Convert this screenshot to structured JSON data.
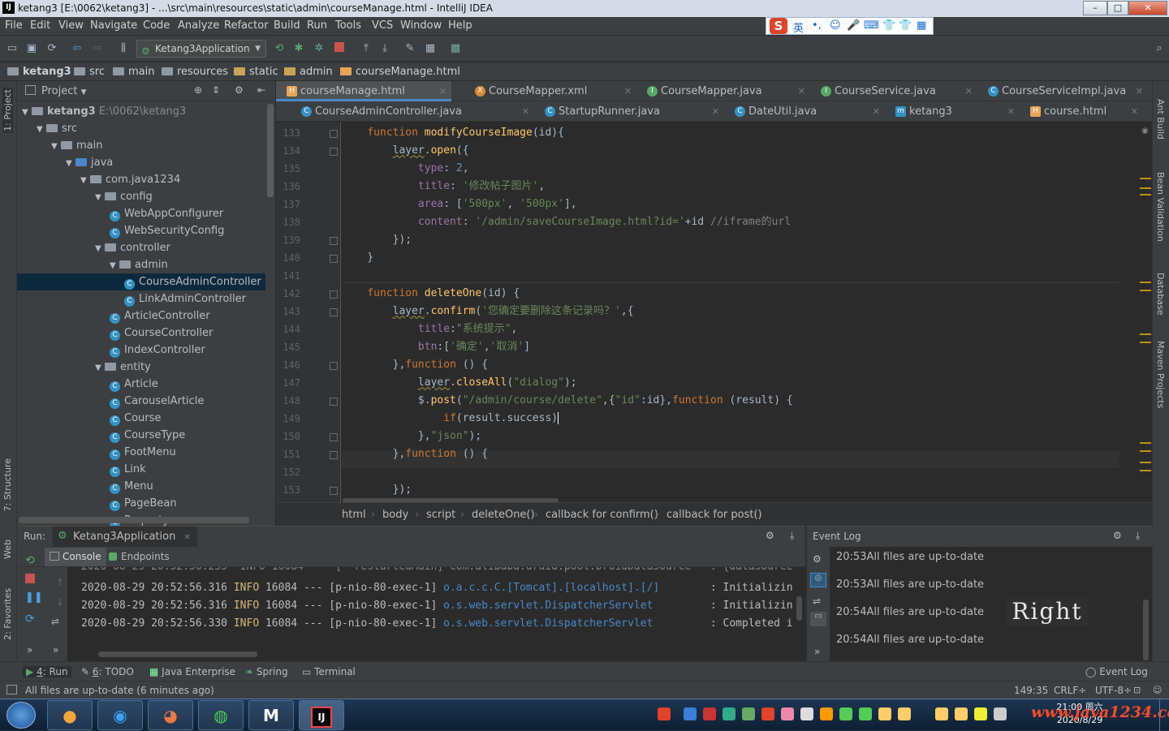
{
  "window": {
    "title": "ketang3 [E:\\0062\\ketang3] - ...\\src\\main\\resources\\static\\admin\\courseManage.html - IntelliJ IDEA",
    "app_icon": "IJ",
    "min": "–",
    "max": "□",
    "close": "✕"
  },
  "menu": [
    "File",
    "Edit",
    "View",
    "Navigate",
    "Code",
    "Analyze",
    "Refactor",
    "Build",
    "Run",
    "Tools",
    "VCS",
    "Window",
    "Help"
  ],
  "ime": {
    "logo": "S",
    "lang": "英",
    "items": [
      "•,",
      "☺",
      "🎤",
      "⌨",
      "👕",
      "👕",
      "▦"
    ]
  },
  "toolbar": {
    "run_config": "Ketang3Application"
  },
  "nav": {
    "crumbs": [
      "ketang3",
      "src",
      "main",
      "resources",
      "static",
      "admin",
      "courseManage.html"
    ]
  },
  "project": {
    "title": "Project",
    "tree": [
      {
        "label": "ketang3",
        "extra": "E:\\0062\\ketang3",
        "depth": 0,
        "type": "module",
        "open": true
      },
      {
        "label": "src",
        "depth": 1,
        "type": "folder",
        "open": true
      },
      {
        "label": "main",
        "depth": 2,
        "type": "folder",
        "open": true
      },
      {
        "label": "java",
        "depth": 3,
        "type": "folder",
        "open": true
      },
      {
        "label": "com.java1234",
        "depth": 4,
        "type": "package",
        "open": true
      },
      {
        "label": "config",
        "depth": 5,
        "type": "package",
        "open": true
      },
      {
        "label": "WebAppConfigurer",
        "depth": 6,
        "type": "class"
      },
      {
        "label": "WebSecurityConfig",
        "depth": 6,
        "type": "class"
      },
      {
        "label": "controller",
        "depth": 5,
        "type": "package",
        "open": true
      },
      {
        "label": "admin",
        "depth": 6,
        "type": "package",
        "open": true
      },
      {
        "label": "CourseAdminController",
        "depth": 7,
        "type": "class",
        "selected": true
      },
      {
        "label": "LinkAdminController",
        "depth": 7,
        "type": "class"
      },
      {
        "label": "ArticleController",
        "depth": 6,
        "type": "class"
      },
      {
        "label": "CourseController",
        "depth": 6,
        "type": "class"
      },
      {
        "label": "IndexController",
        "depth": 6,
        "type": "class"
      },
      {
        "label": "entity",
        "depth": 5,
        "type": "package",
        "open": true
      },
      {
        "label": "Article",
        "depth": 6,
        "type": "class"
      },
      {
        "label": "CarouselArticle",
        "depth": 6,
        "type": "class"
      },
      {
        "label": "Course",
        "depth": 6,
        "type": "class"
      },
      {
        "label": "CourseType",
        "depth": 6,
        "type": "class"
      },
      {
        "label": "FootMenu",
        "depth": 6,
        "type": "class"
      },
      {
        "label": "Link",
        "depth": 6,
        "type": "class"
      },
      {
        "label": "Menu",
        "depth": 6,
        "type": "class"
      },
      {
        "label": "PageBean",
        "depth": 6,
        "type": "class"
      },
      {
        "label": "Property",
        "depth": 6,
        "type": "class"
      }
    ]
  },
  "tabs_row1": [
    {
      "label": "courseManage.html",
      "icon": "html",
      "active": true
    },
    {
      "label": "CourseMapper.xml",
      "icon": "xml"
    },
    {
      "label": "CourseMapper.java",
      "icon": "interface"
    },
    {
      "label": "CourseService.java",
      "icon": "interface"
    },
    {
      "label": "CourseServiceImpl.java",
      "icon": "class"
    }
  ],
  "tabs_row2": [
    {
      "label": "CourseAdminController.java",
      "icon": "class"
    },
    {
      "label": "StartupRunner.java",
      "icon": "class"
    },
    {
      "label": "DateUtil.java",
      "icon": "class"
    },
    {
      "label": "ketang3",
      "icon": "maven"
    },
    {
      "label": "course.html",
      "icon": "html"
    }
  ],
  "line_numbers": [
    "133",
    "134",
    "135",
    "136",
    "137",
    "138",
    "139",
    "140",
    "141",
    "142",
    "143",
    "144",
    "145",
    "146",
    "147",
    "148",
    "149",
    "150",
    "151",
    "152",
    "153"
  ],
  "code": [
    [
      [
        "    ",
        ""
      ],
      [
        "function ",
        "kw"
      ],
      [
        "modifyCourseImage",
        "fn"
      ],
      [
        "(id){",
        ""
      ]
    ],
    [
      [
        "        ",
        ""
      ],
      [
        "layer",
        "wav"
      ],
      [
        ".",
        ""
      ],
      [
        "open",
        "fn"
      ],
      [
        "({",
        ""
      ]
    ],
    [
      [
        "            ",
        ""
      ],
      [
        "type",
        "pr"
      ],
      [
        ": ",
        ""
      ],
      [
        "2",
        "nm"
      ],
      [
        ",",
        ""
      ]
    ],
    [
      [
        "            ",
        ""
      ],
      [
        "title",
        "pr"
      ],
      [
        ": ",
        ""
      ],
      [
        "'修改帖子图片'",
        "st"
      ],
      [
        ",",
        ""
      ]
    ],
    [
      [
        "            ",
        ""
      ],
      [
        "area",
        "pr"
      ],
      [
        ": [",
        ""
      ],
      [
        "'500px'",
        "st"
      ],
      [
        ", ",
        ""
      ],
      [
        "'500px'",
        "st"
      ],
      [
        "],",
        ""
      ]
    ],
    [
      [
        "            ",
        ""
      ],
      [
        "content",
        "pr"
      ],
      [
        ": ",
        ""
      ],
      [
        "'/admin/saveCourseImage.html?id='",
        "st"
      ],
      [
        "+id ",
        ""
      ],
      [
        "//iframe的url",
        "cm"
      ]
    ],
    [
      [
        "        });",
        ""
      ]
    ],
    [
      [
        "    }",
        ""
      ]
    ],
    [
      [
        "",
        ""
      ]
    ],
    [
      [
        "    ",
        ""
      ],
      [
        "function ",
        "kw"
      ],
      [
        "deleteOne",
        "fn"
      ],
      [
        "(id) {",
        ""
      ]
    ],
    [
      [
        "        ",
        ""
      ],
      [
        "layer",
        "wav"
      ],
      [
        ".",
        ""
      ],
      [
        "confirm",
        "fn"
      ],
      [
        "(",
        ""
      ],
      [
        "'您确定要删除这条记录吗？'",
        "st"
      ],
      [
        ",{",
        ""
      ]
    ],
    [
      [
        "            ",
        ""
      ],
      [
        "title",
        "pr"
      ],
      [
        ":",
        ""
      ],
      [
        "\"系统提示\"",
        "st"
      ],
      [
        ",",
        ""
      ]
    ],
    [
      [
        "            ",
        ""
      ],
      [
        "btn",
        "pr"
      ],
      [
        ":[",
        ""
      ],
      [
        "'确定'",
        "st"
      ],
      [
        ",",
        ""
      ],
      [
        "'取消'",
        "st"
      ],
      [
        "]",
        ""
      ]
    ],
    [
      [
        "        },",
        ""
      ],
      [
        "function ",
        "kw"
      ],
      [
        "() {",
        ""
      ]
    ],
    [
      [
        "            ",
        ""
      ],
      [
        "layer",
        "wav"
      ],
      [
        ".",
        ""
      ],
      [
        "closeAll",
        "fn"
      ],
      [
        "(",
        ""
      ],
      [
        "\"dialog\"",
        "st"
      ],
      [
        ");",
        ""
      ]
    ],
    [
      [
        "            ",
        ""
      ],
      [
        "$",
        ""
      ],
      [
        ".",
        ""
      ],
      [
        "post",
        "fn"
      ],
      [
        "(",
        ""
      ],
      [
        "\"/admin/course/delete\"",
        "st"
      ],
      [
        ",{",
        ""
      ],
      [
        "\"id\"",
        "st"
      ],
      [
        ":id},",
        ""
      ],
      [
        "function ",
        "kw"
      ],
      [
        "(result) {",
        ""
      ]
    ],
    [
      [
        "                ",
        ""
      ],
      [
        "if",
        "kw"
      ],
      [
        "(result.success)",
        ""
      ]
    ],
    [
      [
        "            },",
        ""
      ],
      [
        "\"json\"",
        "st"
      ],
      [
        ");",
        ""
      ]
    ],
    [
      [
        "        },",
        ""
      ],
      [
        "function ",
        "kw"
      ],
      [
        "() {",
        ""
      ]
    ],
    [
      [
        "",
        ""
      ]
    ],
    [
      [
        "        });",
        ""
      ]
    ]
  ],
  "editor_breadcrumb": [
    "html",
    "body",
    "script",
    "deleteOne()",
    "callback for confirm()",
    "callback for post()"
  ],
  "run": {
    "label": "Run:",
    "config": "Ketang3Application",
    "tabs": [
      "Console",
      "Endpoints"
    ],
    "log": [
      {
        "ts": "2020-08-29 20:52:56.316",
        "level": "INFO",
        "pid": "16084",
        "sep": "---",
        "thread": "[p-nio-80-exec-1]",
        "logger": "o.a.c.c.C.[Tomcat].[localhost].[/]",
        "msg": ": Initializin"
      },
      {
        "ts": "2020-08-29 20:52:56.316",
        "level": "INFO",
        "pid": "16084",
        "sep": "---",
        "thread": "[p-nio-80-exec-1]",
        "logger": "o.s.web.servlet.DispatcherServlet",
        "msg": ": Initializin"
      },
      {
        "ts": "2020-08-29 20:52:56.330",
        "level": "INFO",
        "pid": "16084",
        "sep": "---",
        "thread": "[p-nio-80-exec-1]",
        "logger": "o.s.web.servlet.DispatcherServlet",
        "msg": ": Completed i"
      }
    ]
  },
  "event_log": {
    "title": "Event Log",
    "entries": [
      {
        "time": "20:53",
        "text": "All files are up-to-date"
      },
      {
        "time": "20:53",
        "text": "All files are up-to-date"
      },
      {
        "time": "20:54",
        "text": "All files are up-to-date"
      },
      {
        "time": "20:54",
        "text": "All files are up-to-date"
      }
    ]
  },
  "watermark": "Right",
  "tool_windows": [
    {
      "num": "4",
      "label": ": Run"
    },
    {
      "num": "6",
      "label": ": TODO"
    },
    {
      "num": "",
      "label": "Java Enterprise"
    },
    {
      "num": "",
      "label": "Spring"
    },
    {
      "num": "",
      "label": "Terminal"
    }
  ],
  "event_log_button": "Event Log",
  "side_tabs_left": [
    "1: Project",
    "7: Structure",
    "Web",
    "2: Favorites"
  ],
  "side_tabs_right": [
    "Ant Build",
    "Bean Validation",
    "Database",
    "Maven Projects"
  ],
  "status": {
    "message": "All files are up-to-date (6 minutes ago)",
    "position": "149:35",
    "line_sep": "CRLF÷",
    "encoding": "UTF-8÷"
  },
  "taskbar": {
    "time": "21:00 周六",
    "date": "2020/8/29",
    "url_watermark": "www.java1234.com",
    "jb_icon": "IJ"
  }
}
